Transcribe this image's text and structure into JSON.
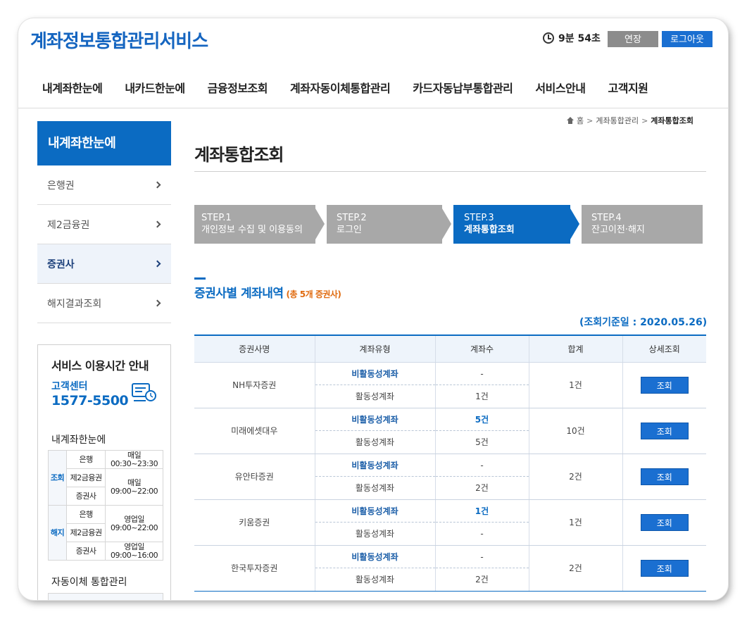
{
  "header": {
    "logo": "계좌정보통합관리서비스",
    "timer": "9분 54초",
    "extend_label": "연장",
    "logout_label": "로그아웃"
  },
  "gnb": [
    "내계좌한눈에",
    "내카드한눈에",
    "금융정보조회",
    "계좌자동이체통합관리",
    "카드자동납부통합관리",
    "서비스안내",
    "고객지원"
  ],
  "sidebar": {
    "title": "내계좌한눈에",
    "items": [
      {
        "label": "은행권"
      },
      {
        "label": "제2금융권"
      },
      {
        "label": "증권사"
      },
      {
        "label": "해지결과조회"
      }
    ],
    "service_box": {
      "title": "서비스 이용시간 안내",
      "center_label": "고객센터",
      "center_phone": "1577-5500",
      "sub_title": "내계좌한눈에",
      "rows": {
        "inquiry": "조회",
        "cancel": "해지",
        "bank": "은행",
        "fin2": "제2금융권",
        "sec": "증권사",
        "daily": "매일",
        "t1": "00:30~23:30",
        "t2": "09:00~22:00",
        "bizday": "영업일",
        "t3": "09:00~22:00",
        "t4": "09:00~16:00"
      },
      "sub_title2": "자동이체 통합관리"
    }
  },
  "breadcrumb": {
    "home": "홈",
    "level1": "계좌통합관리",
    "current": "계좌통합조회"
  },
  "page_title": "계좌통합조회",
  "steps": [
    {
      "num": "STEP.1",
      "label": "개인정보 수집 및 이용동의"
    },
    {
      "num": "STEP.2",
      "label": "로그인"
    },
    {
      "num": "STEP.3",
      "label": "계좌통합조회"
    },
    {
      "num": "STEP.4",
      "label": "잔고이전·해지"
    }
  ],
  "section": {
    "title": "증권사별 계좌내역",
    "count": "(총 5개 증권사)",
    "base_date": "(조회기준일 : 2020.05.26)"
  },
  "table": {
    "headers": [
      "증권사명",
      "계좌유형",
      "계좌수",
      "합계",
      "상세조회"
    ],
    "inactive_label": "비활동성계좌",
    "active_label": "활동성계좌",
    "button_label": "조회",
    "rows": [
      {
        "name": "NH투자증권",
        "inactive_count": "-",
        "active_count": "1건",
        "total": "1건"
      },
      {
        "name": "미래에셋대우",
        "inactive_count": "5건",
        "active_count": "5건",
        "total": "10건"
      },
      {
        "name": "유안타증권",
        "inactive_count": "-",
        "active_count": "2건",
        "total": "2건"
      },
      {
        "name": "키움증권",
        "inactive_count": "1건",
        "active_count": "-",
        "total": "1건"
      },
      {
        "name": "한국투자증권",
        "inactive_count": "-",
        "active_count": "2건",
        "total": "2건"
      }
    ]
  },
  "colors": {
    "primary": "#0b6bc2",
    "button_blue": "#1a6fd1",
    "step_gray": "#a8a8a8",
    "accent_orange": "#e06b10"
  }
}
